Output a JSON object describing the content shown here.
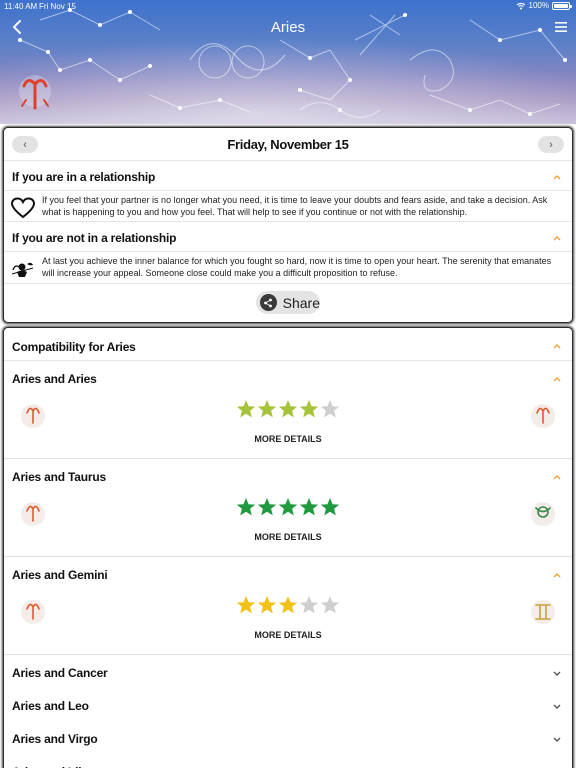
{
  "status_bar": {
    "time": "11:40 AM",
    "date": "Fri Nov 15",
    "battery": "100%"
  },
  "header": {
    "title": "Aries",
    "back_icon": "chevron-left-icon",
    "menu_icon": "hamburger-menu-icon"
  },
  "horoscope": {
    "date": "Friday, November 15",
    "prev_icon": "chevron-left-icon",
    "next_icon": "chevron-right-icon",
    "sections": [
      {
        "title": "If you are in a relationship",
        "icon": "heart-icon",
        "text": "If you feel that your partner is no longer what you need, it is time to leave your doubts and fears aside, and take a decision. Ask what is happening to you and how you feel. That will help to see if you continue or not with the relationship."
      },
      {
        "title": "If you are not in a relationship",
        "icon": "cupid-icon",
        "text": "At last you achieve the inner balance for which you fought so hard, now it is time to open your heart. The serenity that emanates will increase your appeal. Someone close could make you a difficult proposition to refuse."
      }
    ],
    "share_label": "Share"
  },
  "compatibility": {
    "title": "Compatibility for Aries",
    "pairs": [
      {
        "label": "Aries and Aries",
        "stars": 4,
        "star_color": "#a6c43a",
        "more": "MORE DETAILS",
        "left_icon": "aries-icon",
        "right_icon": "aries-icon"
      },
      {
        "label": "Aries and Taurus",
        "stars": 5,
        "star_color": "#1f9a3f",
        "more": "MORE DETAILS",
        "left_icon": "aries-icon",
        "right_icon": "taurus-icon"
      },
      {
        "label": "Aries and Gemini",
        "stars": 3,
        "star_color": "#f2c21b",
        "more": "MORE DETAILS",
        "left_icon": "aries-icon",
        "right_icon": "gemini-icon"
      }
    ],
    "collapsed": [
      {
        "label": "Aries and Cancer"
      },
      {
        "label": "Aries and Leo"
      },
      {
        "label": "Aries and Virgo"
      },
      {
        "label": "Aries and Libra"
      }
    ]
  },
  "colors": {
    "accent": "#f0a030",
    "empty_star": "#cfcfcf"
  }
}
